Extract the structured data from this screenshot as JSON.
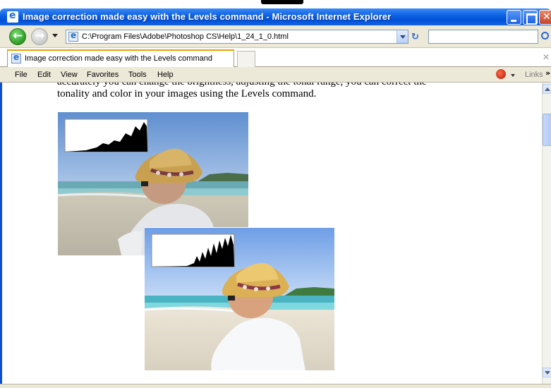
{
  "window": {
    "title": "Image correction made easy with the Levels command - Microsoft Internet Explorer"
  },
  "navigation": {
    "address_url": "C:\\Program Files\\Adobe\\Photoshop CS\\Help\\1_24_1_0.html",
    "search_value": ""
  },
  "tabs": [
    {
      "label": "Image correction made easy with the Levels command"
    }
  ],
  "menu": {
    "items": [
      "File",
      "Edit",
      "View",
      "Favorites",
      "Tools",
      "Help"
    ],
    "links_label": "Links",
    "links_more": "»"
  },
  "content": {
    "cut_line": "accurately you can change the brightness, adjusting the tonal range, you can correct the",
    "body_text": "tonality and color in your images using the Levels command."
  },
  "icons": {
    "back": "back-arrow-icon",
    "forward": "forward-arrow-icon",
    "refresh": "refresh-icon",
    "search": "search-icon",
    "close": "close-icon"
  }
}
